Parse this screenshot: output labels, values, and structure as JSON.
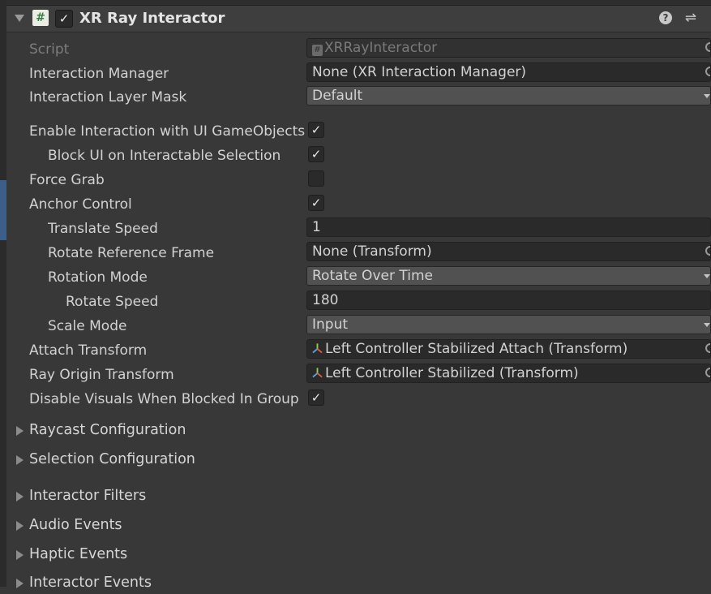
{
  "component": {
    "title": "XR Ray Interactor",
    "enabled_mark": "✓",
    "help_icon": "?",
    "presets_icon": "⇌"
  },
  "fields": {
    "script": {
      "label": "Script",
      "value": "XRRayInteractor"
    },
    "interaction_manager": {
      "label": "Interaction Manager",
      "value": "None (XR Interaction Manager)"
    },
    "interaction_layer_mask": {
      "label": "Interaction Layer Mask",
      "value": "Default"
    },
    "enable_ui": {
      "label": "Enable Interaction with UI GameObjects",
      "checked": true
    },
    "block_ui": {
      "label": "Block UI on Interactable Selection",
      "checked": true
    },
    "force_grab": {
      "label": "Force Grab",
      "checked": false
    },
    "anchor_control": {
      "label": "Anchor Control",
      "checked": true
    },
    "translate_speed": {
      "label": "Translate Speed",
      "value": "1"
    },
    "rotate_reference_frame": {
      "label": "Rotate Reference Frame",
      "value": "None (Transform)"
    },
    "rotation_mode": {
      "label": "Rotation Mode",
      "value": "Rotate Over Time"
    },
    "rotate_speed": {
      "label": "Rotate Speed",
      "value": "180"
    },
    "scale_mode": {
      "label": "Scale Mode",
      "value": "Input"
    },
    "attach_transform": {
      "label": "Attach Transform",
      "value": "Left Controller Stabilized Attach (Transform)"
    },
    "ray_origin_transform": {
      "label": "Ray Origin Transform",
      "value": "Left Controller Stabilized (Transform)"
    },
    "disable_visuals": {
      "label": "Disable Visuals When Blocked In Group",
      "checked": true
    }
  },
  "checkmark": "✓",
  "sections": [
    {
      "label": "Raycast Configuration"
    },
    {
      "label": "Selection Configuration"
    },
    {
      "label": "Interactor Filters"
    },
    {
      "label": "Audio Events"
    },
    {
      "label": "Haptic Events"
    },
    {
      "label": "Interactor Events"
    }
  ]
}
